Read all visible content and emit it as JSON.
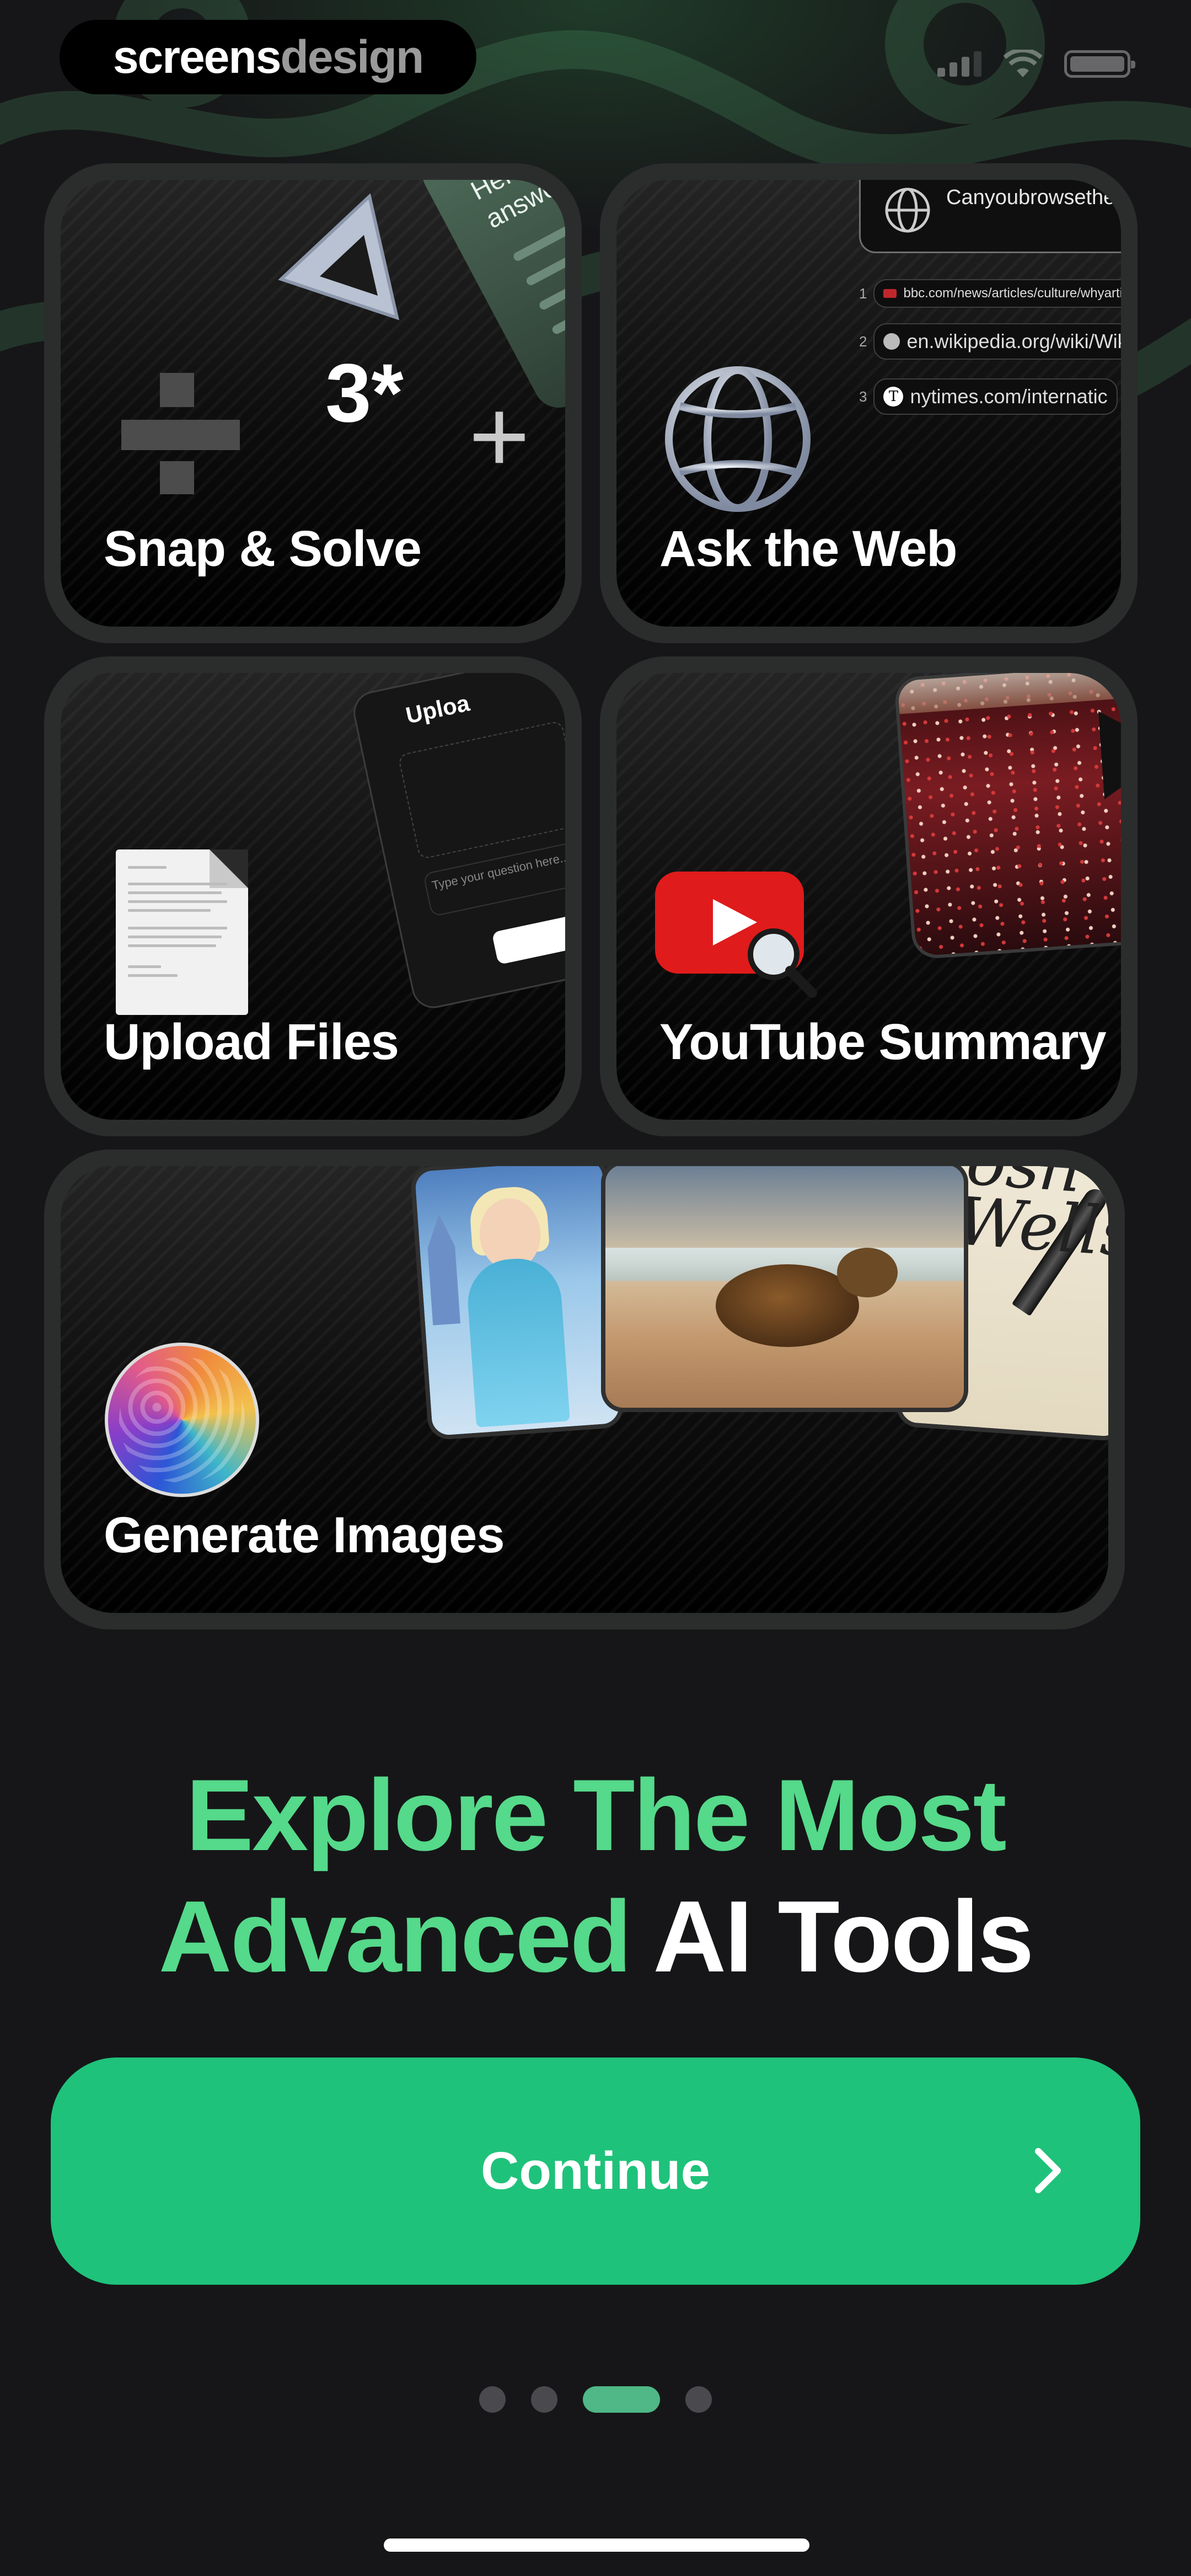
{
  "brand": {
    "part1": "screens",
    "part2": "design"
  },
  "status": {
    "signal": "signal-icon",
    "wifi": "wifi-icon",
    "battery": "battery-icon"
  },
  "features": [
    {
      "label": "Snap & Solve",
      "icon": "math-icon"
    },
    {
      "label": "Ask the Web",
      "icon": "globe-icon"
    },
    {
      "label": "Upload Files",
      "icon": "document-icon"
    },
    {
      "label": "YouTube Summary",
      "icon": "youtube-icon"
    },
    {
      "label": "Generate Images",
      "icon": "gradient-avatar-icon"
    }
  ],
  "snap": {
    "answer_card": "Here's your answer",
    "digit": "3*"
  },
  "web": {
    "query": "Canyoubrowsethe someinsightsabout",
    "sources": [
      {
        "num": "1",
        "url": "bbc.com/news/articles/culture/whyartistfail"
      },
      {
        "num": "2",
        "url": "en.wikipedia.org/wiki/Wikip"
      },
      {
        "num": "3",
        "url": "nytimes.com/internatic"
      }
    ]
  },
  "upload_phone": {
    "title": "Uploa",
    "placeholder": "Type your question here..."
  },
  "headline": {
    "line1": "Explore The Most",
    "line2_green": "Advanced",
    "line2_white": " AI Tools"
  },
  "colors": {
    "accent": "#1fc27a",
    "headline_green": "#55d98a",
    "background": "#161618"
  },
  "cta": {
    "label": "Continue",
    "icon": "chevron-right-icon"
  },
  "pager": {
    "count": 4,
    "active": 3
  }
}
